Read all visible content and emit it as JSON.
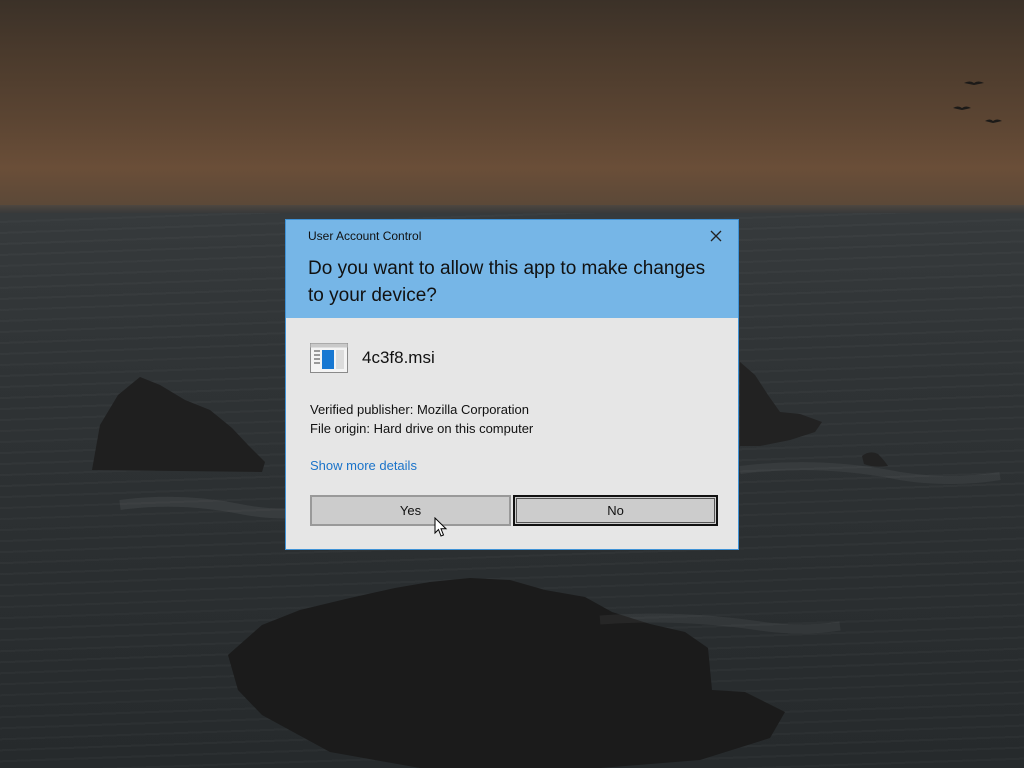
{
  "dialog": {
    "caption": "User Account Control",
    "question": "Do you want to allow this app to make changes to your device?",
    "app_name": "4c3f8.msi",
    "publisher": "Verified publisher: Mozilla Corporation",
    "origin": "File origin: Hard drive on this computer",
    "more_details": "Show more details",
    "yes_label": "Yes",
    "no_label": "No"
  },
  "icons": {
    "close": "close-icon",
    "app": "installer-package-icon",
    "cursor": "mouse-pointer-icon"
  },
  "colors": {
    "header": "#76b6e7",
    "body": "#e6e6e6",
    "link": "#1a73c9",
    "border": "#3f92d6"
  }
}
